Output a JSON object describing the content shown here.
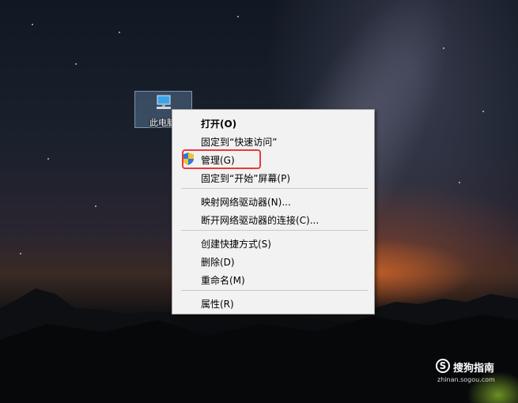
{
  "desktop": {
    "icon_label": "此电脑",
    "icon_name": "this-pc-icon"
  },
  "context_menu": {
    "items": [
      {
        "label": "打开(O)",
        "bold": true
      },
      {
        "label": "固定到“快速访问”"
      },
      {
        "label": "管理(G)",
        "icon": "shield-icon",
        "highlighted": true
      },
      {
        "label": "固定到“开始”屏幕(P)"
      },
      {
        "label": "映射网络驱动器(N)..."
      },
      {
        "label": "断开网络驱动器的连接(C)..."
      },
      {
        "label": "创建快捷方式(S)"
      },
      {
        "label": "删除(D)"
      },
      {
        "label": "重命名(M)"
      },
      {
        "label": "属性(R)"
      }
    ]
  },
  "annotation": {
    "color": "#e83a3a"
  },
  "watermark": {
    "symbol": "S",
    "brand": "搜狗指南",
    "url": "zhinan.sogou.com"
  }
}
